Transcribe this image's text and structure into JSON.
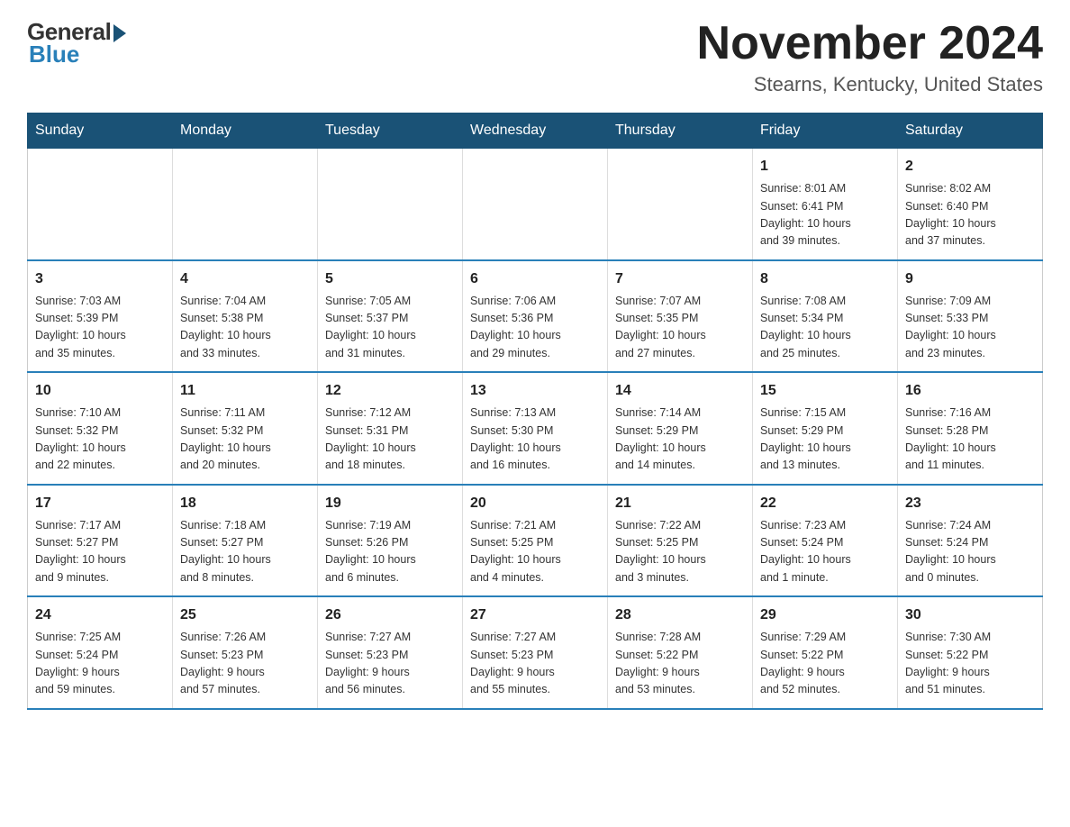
{
  "logo": {
    "general": "General",
    "blue": "Blue"
  },
  "title": {
    "month_year": "November 2024",
    "location": "Stearns, Kentucky, United States"
  },
  "days_of_week": [
    "Sunday",
    "Monday",
    "Tuesday",
    "Wednesday",
    "Thursday",
    "Friday",
    "Saturday"
  ],
  "weeks": [
    {
      "days": [
        {
          "number": "",
          "info": ""
        },
        {
          "number": "",
          "info": ""
        },
        {
          "number": "",
          "info": ""
        },
        {
          "number": "",
          "info": ""
        },
        {
          "number": "",
          "info": ""
        },
        {
          "number": "1",
          "info": "Sunrise: 8:01 AM\nSunset: 6:41 PM\nDaylight: 10 hours\nand 39 minutes."
        },
        {
          "number": "2",
          "info": "Sunrise: 8:02 AM\nSunset: 6:40 PM\nDaylight: 10 hours\nand 37 minutes."
        }
      ]
    },
    {
      "days": [
        {
          "number": "3",
          "info": "Sunrise: 7:03 AM\nSunset: 5:39 PM\nDaylight: 10 hours\nand 35 minutes."
        },
        {
          "number": "4",
          "info": "Sunrise: 7:04 AM\nSunset: 5:38 PM\nDaylight: 10 hours\nand 33 minutes."
        },
        {
          "number": "5",
          "info": "Sunrise: 7:05 AM\nSunset: 5:37 PM\nDaylight: 10 hours\nand 31 minutes."
        },
        {
          "number": "6",
          "info": "Sunrise: 7:06 AM\nSunset: 5:36 PM\nDaylight: 10 hours\nand 29 minutes."
        },
        {
          "number": "7",
          "info": "Sunrise: 7:07 AM\nSunset: 5:35 PM\nDaylight: 10 hours\nand 27 minutes."
        },
        {
          "number": "8",
          "info": "Sunrise: 7:08 AM\nSunset: 5:34 PM\nDaylight: 10 hours\nand 25 minutes."
        },
        {
          "number": "9",
          "info": "Sunrise: 7:09 AM\nSunset: 5:33 PM\nDaylight: 10 hours\nand 23 minutes."
        }
      ]
    },
    {
      "days": [
        {
          "number": "10",
          "info": "Sunrise: 7:10 AM\nSunset: 5:32 PM\nDaylight: 10 hours\nand 22 minutes."
        },
        {
          "number": "11",
          "info": "Sunrise: 7:11 AM\nSunset: 5:32 PM\nDaylight: 10 hours\nand 20 minutes."
        },
        {
          "number": "12",
          "info": "Sunrise: 7:12 AM\nSunset: 5:31 PM\nDaylight: 10 hours\nand 18 minutes."
        },
        {
          "number": "13",
          "info": "Sunrise: 7:13 AM\nSunset: 5:30 PM\nDaylight: 10 hours\nand 16 minutes."
        },
        {
          "number": "14",
          "info": "Sunrise: 7:14 AM\nSunset: 5:29 PM\nDaylight: 10 hours\nand 14 minutes."
        },
        {
          "number": "15",
          "info": "Sunrise: 7:15 AM\nSunset: 5:29 PM\nDaylight: 10 hours\nand 13 minutes."
        },
        {
          "number": "16",
          "info": "Sunrise: 7:16 AM\nSunset: 5:28 PM\nDaylight: 10 hours\nand 11 minutes."
        }
      ]
    },
    {
      "days": [
        {
          "number": "17",
          "info": "Sunrise: 7:17 AM\nSunset: 5:27 PM\nDaylight: 10 hours\nand 9 minutes."
        },
        {
          "number": "18",
          "info": "Sunrise: 7:18 AM\nSunset: 5:27 PM\nDaylight: 10 hours\nand 8 minutes."
        },
        {
          "number": "19",
          "info": "Sunrise: 7:19 AM\nSunset: 5:26 PM\nDaylight: 10 hours\nand 6 minutes."
        },
        {
          "number": "20",
          "info": "Sunrise: 7:21 AM\nSunset: 5:25 PM\nDaylight: 10 hours\nand 4 minutes."
        },
        {
          "number": "21",
          "info": "Sunrise: 7:22 AM\nSunset: 5:25 PM\nDaylight: 10 hours\nand 3 minutes."
        },
        {
          "number": "22",
          "info": "Sunrise: 7:23 AM\nSunset: 5:24 PM\nDaylight: 10 hours\nand 1 minute."
        },
        {
          "number": "23",
          "info": "Sunrise: 7:24 AM\nSunset: 5:24 PM\nDaylight: 10 hours\nand 0 minutes."
        }
      ]
    },
    {
      "days": [
        {
          "number": "24",
          "info": "Sunrise: 7:25 AM\nSunset: 5:24 PM\nDaylight: 9 hours\nand 59 minutes."
        },
        {
          "number": "25",
          "info": "Sunrise: 7:26 AM\nSunset: 5:23 PM\nDaylight: 9 hours\nand 57 minutes."
        },
        {
          "number": "26",
          "info": "Sunrise: 7:27 AM\nSunset: 5:23 PM\nDaylight: 9 hours\nand 56 minutes."
        },
        {
          "number": "27",
          "info": "Sunrise: 7:27 AM\nSunset: 5:23 PM\nDaylight: 9 hours\nand 55 minutes."
        },
        {
          "number": "28",
          "info": "Sunrise: 7:28 AM\nSunset: 5:22 PM\nDaylight: 9 hours\nand 53 minutes."
        },
        {
          "number": "29",
          "info": "Sunrise: 7:29 AM\nSunset: 5:22 PM\nDaylight: 9 hours\nand 52 minutes."
        },
        {
          "number": "30",
          "info": "Sunrise: 7:30 AM\nSunset: 5:22 PM\nDaylight: 9 hours\nand 51 minutes."
        }
      ]
    }
  ]
}
